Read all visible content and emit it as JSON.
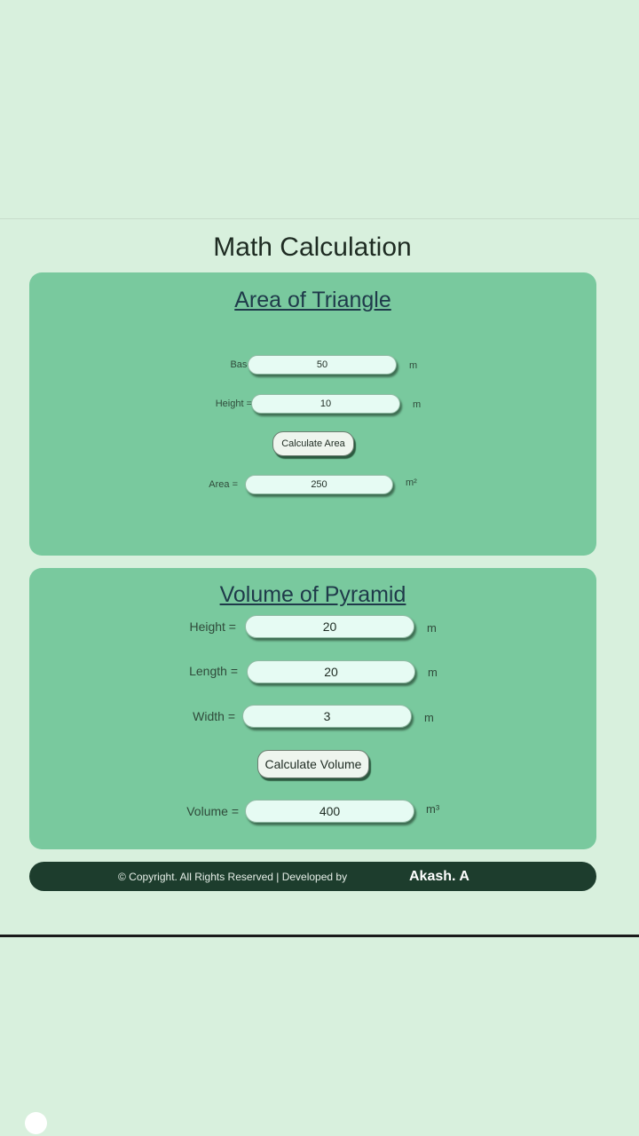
{
  "page_title": "Math Calculation",
  "triangle": {
    "title": "Area of Triangle",
    "base_label": "Base =",
    "base_value": "50",
    "base_unit": "m",
    "height_label": "Height =",
    "height_value": "10",
    "height_unit": "m",
    "button_label": "Calculate Area",
    "area_label": "Area =",
    "area_value": "250",
    "area_unit": "m²"
  },
  "pyramid": {
    "title": "Volume of Pyramid",
    "height_label": "Height =",
    "height_value": "20",
    "height_unit": "m",
    "length_label": "Length =",
    "length_value": "20",
    "length_unit": "m",
    "width_label": "Width =",
    "width_value": "3",
    "width_unit": "m",
    "button_label": "Calculate Volume",
    "volume_label": "Volume =",
    "volume_value": "400",
    "volume_unit": "m³"
  },
  "footer": {
    "text": "© Copyright. All Rights Reserved | Developed by",
    "author": "Akash. A"
  },
  "colors": {
    "page_background": "#d8f0dd",
    "card_background": "#79c99e",
    "footer_background": "#1d3d2d",
    "input_background": "#e6fbf3"
  }
}
